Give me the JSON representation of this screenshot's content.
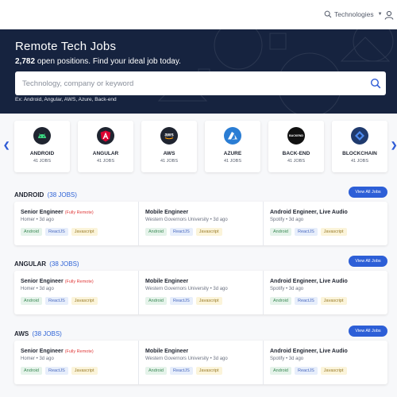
{
  "header": {
    "tech_menu_label": "Technologies"
  },
  "hero": {
    "title": "Remote Tech Jobs",
    "count": "2,782",
    "subtitle": "open positions. Find your ideal job today.",
    "search_placeholder": "Technology, company or keyword",
    "examples": "Ex: Android, Angular, AWS, Azure, Back-end"
  },
  "categories": [
    {
      "name": "ANDROID",
      "count": "41 JOBS",
      "color": "#1f2430",
      "icon": "android-icon"
    },
    {
      "name": "ANGULAR",
      "count": "41 JOBS",
      "color": "#1f2430",
      "icon": "angular-icon"
    },
    {
      "name": "AWS",
      "count": "41 JOBS",
      "color": "#1f2430",
      "icon": "aws-icon"
    },
    {
      "name": "AZURE",
      "count": "41 JOBS",
      "color": "#2a7dd4",
      "icon": "azure-icon"
    },
    {
      "name": "BACK-END",
      "count": "41 JOBS",
      "color": "#111111",
      "icon": "backend-icon",
      "logo_text": "BACKEND"
    },
    {
      "name": "BLOCKCHAIN",
      "count": "41 JOBS",
      "color": "#1f3a6e",
      "icon": "blockchain-icon"
    }
  ],
  "view_all_label": "View All Jobs",
  "sections": [
    {
      "title": "ANDROID",
      "count": "(38 JOBS)",
      "jobs": [
        {
          "title": "Senior Engineer",
          "remote": "(Fully Remote)",
          "company": "Homer",
          "age": "3d ago",
          "tags": [
            "Android",
            "ReactJS",
            "Javascript"
          ]
        },
        {
          "title": "Mobile Engineer",
          "remote": "",
          "company": "Western Governors University",
          "age": "3d ago",
          "tags": [
            "Android",
            "ReactJS",
            "Javascript"
          ]
        },
        {
          "title": "Android Engineer, Live Audio",
          "remote": "",
          "company": "Spotify",
          "age": "3d ago",
          "tags": [
            "Android",
            "ReactJS",
            "Javascript"
          ]
        }
      ]
    },
    {
      "title": "ANGULAR",
      "count": "(38 JOBS)",
      "jobs": [
        {
          "title": "Senior Engineer",
          "remote": "(Fully Remote)",
          "company": "Homer",
          "age": "3d ago",
          "tags": [
            "Android",
            "ReactJS",
            "Javascript"
          ]
        },
        {
          "title": "Mobile Engineer",
          "remote": "",
          "company": "Western Governors University",
          "age": "3d ago",
          "tags": [
            "Android",
            "ReactJS",
            "Javascript"
          ]
        },
        {
          "title": "Android Engineer, Live Audio",
          "remote": "",
          "company": "Spotify",
          "age": "3d ago",
          "tags": [
            "Android",
            "ReactJS",
            "Javascript"
          ]
        }
      ]
    },
    {
      "title": "AWS",
      "count": "(38 JOBS)",
      "jobs": [
        {
          "title": "Senior Engineer",
          "remote": "(Fully Remote)",
          "company": "Homer",
          "age": "3d ago",
          "tags": [
            "Android",
            "ReactJS",
            "Javascript"
          ]
        },
        {
          "title": "Mobile Engineer",
          "remote": "",
          "company": "Western Governors University",
          "age": "3d ago",
          "tags": [
            "Android",
            "ReactJS",
            "Javascript"
          ]
        },
        {
          "title": "Android Engineer, Live Audio",
          "remote": "",
          "company": "Spotify",
          "age": "3d ago",
          "tags": [
            "Android",
            "ReactJS",
            "Javascript"
          ]
        }
      ]
    }
  ]
}
